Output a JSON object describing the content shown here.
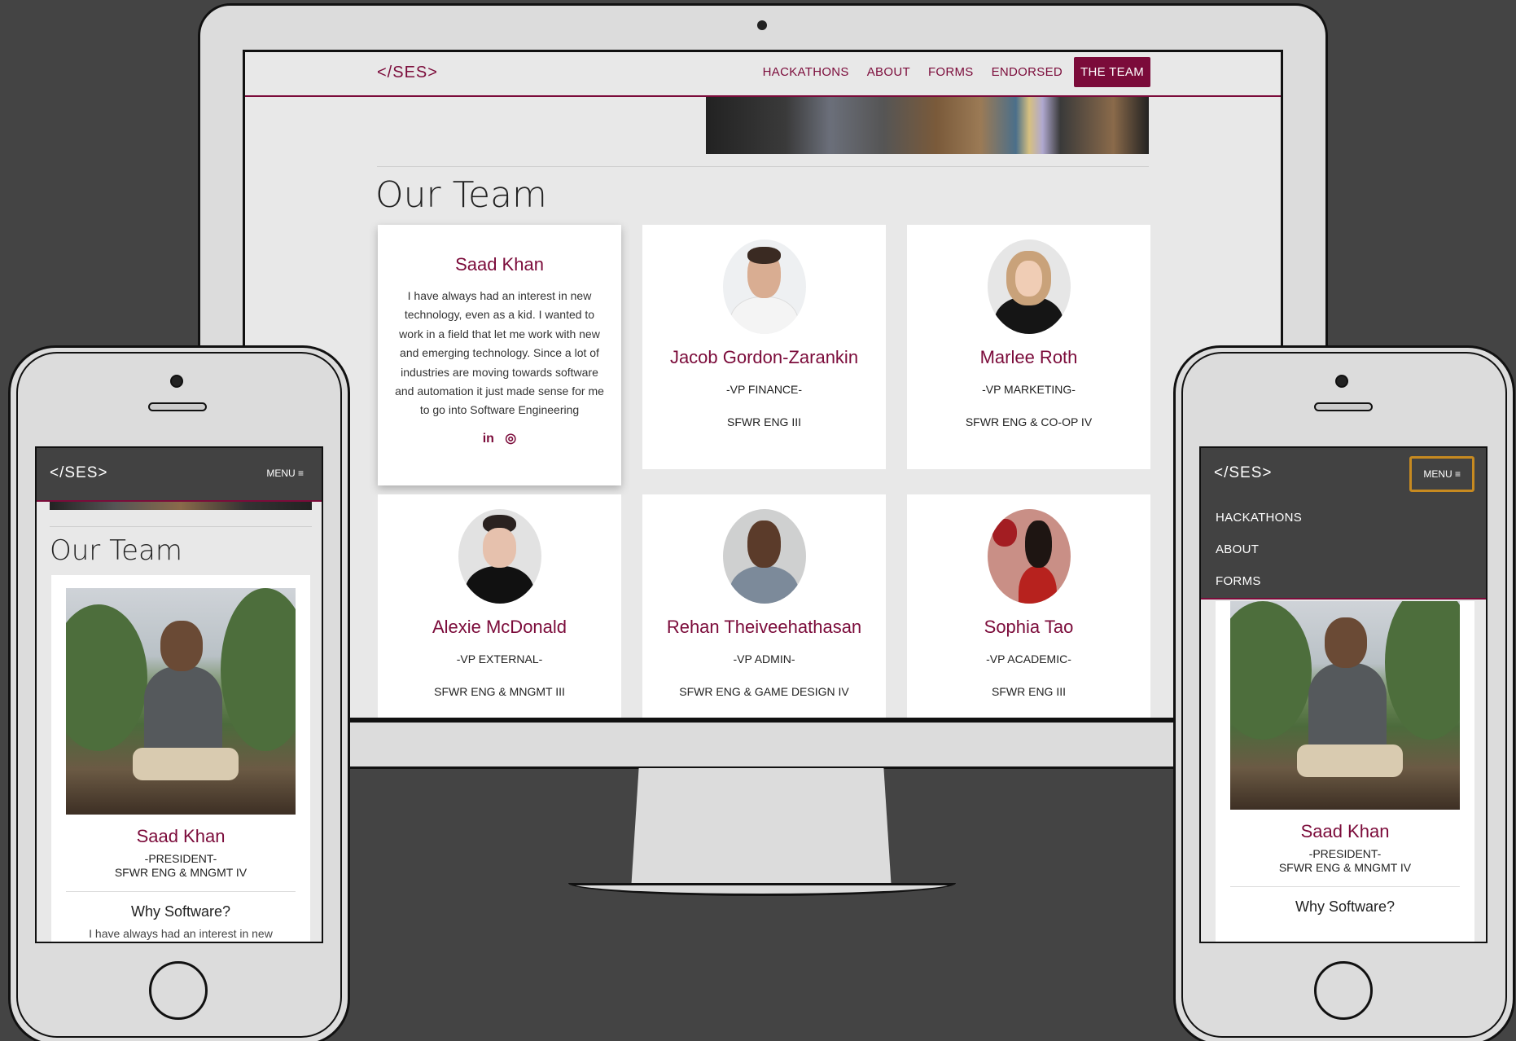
{
  "brand": {
    "logo": "</SES>",
    "accent": "#7b0b3a"
  },
  "desktop": {
    "nav": [
      "HACKATHONS",
      "ABOUT",
      "FORMS",
      "ENDORSED",
      "THE TEAM"
    ],
    "page_title": "Our Team",
    "members": [
      {
        "name": "Saad Khan",
        "bio": "I have always had an interest in new technology, even as a kid. I wanted to work in a field that let me work with new and emerging technology. Since a lot of industries are moving towards software and automation it just made sense for me to go into Software Engineering",
        "social": [
          "linkedin-icon",
          "instagram-icon"
        ],
        "social_glyphs": [
          "in",
          "◎"
        ]
      },
      {
        "name": "Jacob Gordon-Zarankin",
        "role": "-VP FINANCE-",
        "program": "SFWR ENG III"
      },
      {
        "name": "Marlee Roth",
        "role": "-VP MARKETING-",
        "program": "SFWR ENG & CO-OP IV"
      },
      {
        "name": "Alexie McDonald",
        "role": "-VP EXTERNAL-",
        "program": "SFWR ENG & MNGMT III"
      },
      {
        "name": "Rehan Theiveehathasan",
        "role": "-VP ADMIN-",
        "program": "SFWR ENG & GAME DESIGN IV"
      },
      {
        "name": "Sophia Tao",
        "role": "-VP ACADEMIC-",
        "program": "SFWR ENG III"
      }
    ]
  },
  "mobile": {
    "menu_label": "MENU ≡",
    "page_title": "Our Team",
    "menu_links": [
      "HACKATHONS",
      "ABOUT",
      "FORMS"
    ],
    "featured": {
      "name": "Saad Khan",
      "role": "-PRESIDENT-",
      "program": "SFWR ENG & MNGMT IV",
      "section": "Why Software?",
      "cut_text": "I have always had an interest in new"
    }
  }
}
